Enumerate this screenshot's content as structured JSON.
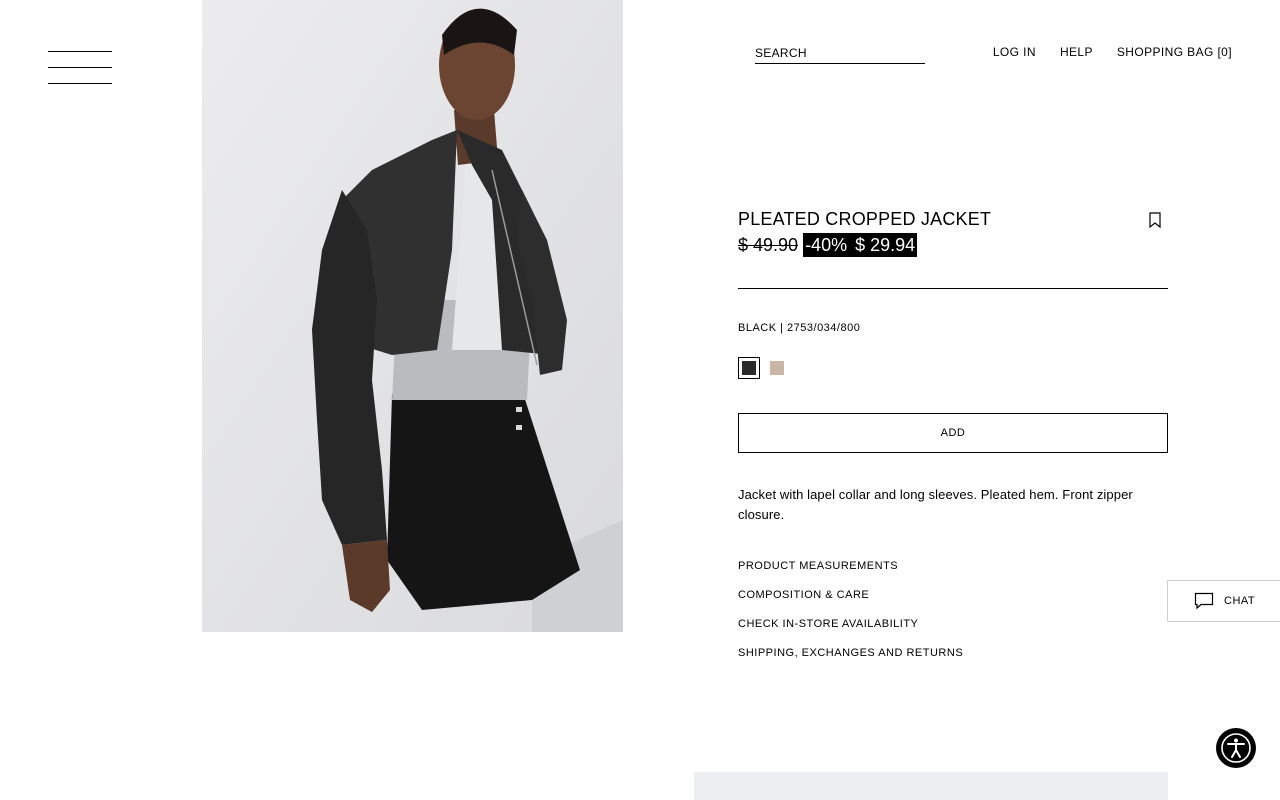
{
  "header": {
    "search_placeholder": "SEARCH",
    "nav": {
      "login": "LOG IN",
      "help": "HELP",
      "bag": "SHOPPING BAG [0]"
    }
  },
  "product": {
    "title": "PLEATED CROPPED JACKET",
    "old_price": "$ 49.90",
    "discount": "-40%",
    "price": "$ 29.94",
    "color_ref": "BLACK | 2753/034/800",
    "swatches": [
      {
        "color": "#2b2b2b",
        "selected": true
      },
      {
        "color": "#cbb3a5",
        "selected": false
      }
    ],
    "add_label": "ADD",
    "description": "Jacket with lapel collar and long sleeves. Pleated hem. Front zipper closure.",
    "links": [
      "PRODUCT MEASUREMENTS",
      "COMPOSITION & CARE",
      "CHECK IN-STORE AVAILABILITY",
      "SHIPPING, EXCHANGES AND RETURNS"
    ]
  },
  "chat": {
    "label": "CHAT"
  },
  "icons": {
    "menu": "hamburger-menu-icon",
    "bookmark": "bookmark-icon",
    "chat": "chat-bubble-icon",
    "accessibility": "accessibility-icon"
  }
}
